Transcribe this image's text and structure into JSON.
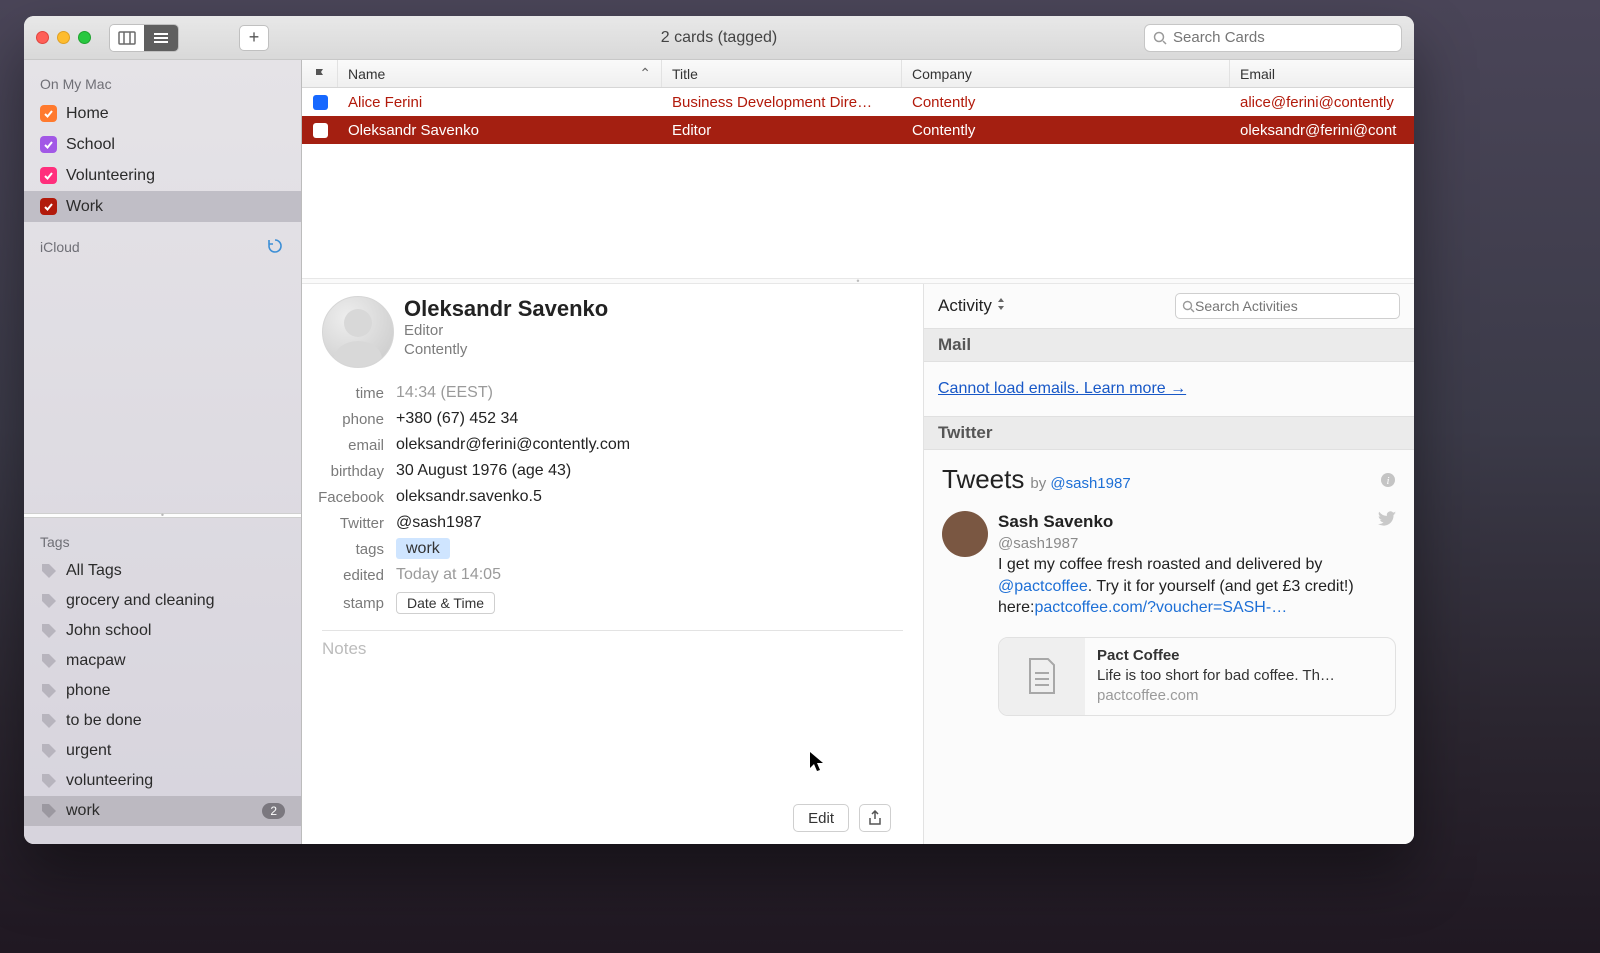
{
  "window": {
    "title": "2 cards (tagged)",
    "search_placeholder": "Search Cards"
  },
  "sidebar": {
    "groups": [
      {
        "label": "On My Mac",
        "items": [
          {
            "label": "Home",
            "color": "#ff7a2e"
          },
          {
            "label": "School",
            "color": "#a258e6"
          },
          {
            "label": "Volunteering",
            "color": "#ff2e7c"
          },
          {
            "label": "Work",
            "color": "#b21a0b",
            "selected": true
          }
        ]
      },
      {
        "label": "iCloud",
        "items": [],
        "refresh": true
      }
    ],
    "tags_header": "Tags",
    "tags": [
      {
        "label": "All Tags"
      },
      {
        "label": "grocery and cleaning"
      },
      {
        "label": "John school"
      },
      {
        "label": "macpaw"
      },
      {
        "label": "phone"
      },
      {
        "label": "to be done"
      },
      {
        "label": "urgent"
      },
      {
        "label": "volunteering"
      },
      {
        "label": "work",
        "count": "2",
        "selected": true
      }
    ]
  },
  "columns": {
    "flag": "",
    "name": "Name",
    "title": "Title",
    "company": "Company",
    "email": "Email"
  },
  "rows": [
    {
      "name": "Alice Ferini",
      "title": "Business Development Dire…",
      "company": "Contently",
      "email": "alice@ferini@contently",
      "flagged": true,
      "kind": "alice"
    },
    {
      "name": "Oleksandr Savenko",
      "title": "Editor",
      "company": "Contently",
      "email": "oleksandr@ferini@cont",
      "flagged": false,
      "kind": "sel"
    }
  ],
  "card": {
    "name": "Oleksandr Savenko",
    "role": "Editor",
    "company": "Contently",
    "fields": [
      {
        "label": "time",
        "value": "14:34 (EEST)",
        "grey": true
      },
      {
        "label": "phone",
        "value": "+380 (67) 452 34"
      },
      {
        "label": "email",
        "value": "oleksandr@ferini@contently.com"
      },
      {
        "label": "birthday",
        "value": "30 August 1976 (age 43)"
      },
      {
        "label": "Facebook",
        "value": "oleksandr.savenko.5"
      },
      {
        "label": "Twitter",
        "value": "@sash1987"
      }
    ],
    "tags_label": "tags",
    "tag_value": "work",
    "edited_label": "edited",
    "edited_value": "Today at 14:05",
    "stamp_label": "stamp",
    "stamp_button": "Date & Time",
    "notes_placeholder": "Notes",
    "edit_button": "Edit"
  },
  "activity": {
    "label": "Activity",
    "search_placeholder": "Search Activities",
    "mail_header": "Mail",
    "mail_link": "Cannot load emails. Learn more →",
    "twitter_header": "Twitter",
    "tweets_title": "Tweets",
    "tweets_by": "by ",
    "tweets_handle": "@sash1987",
    "tweet": {
      "name": "Sash Savenko",
      "handle": "@sash1987",
      "text1": "I get my coffee fresh roasted and delivered by ",
      "mention": "@pactcoffee",
      "text2": ". Try it for yourself (and get £3 credit!) here:",
      "link": "pactcoffee.com/?voucher=SASH-…"
    },
    "linkcard": {
      "title": "Pact Coffee",
      "desc": "Life is too short for bad coffee. Th…",
      "site": "pactcoffee.com"
    }
  }
}
